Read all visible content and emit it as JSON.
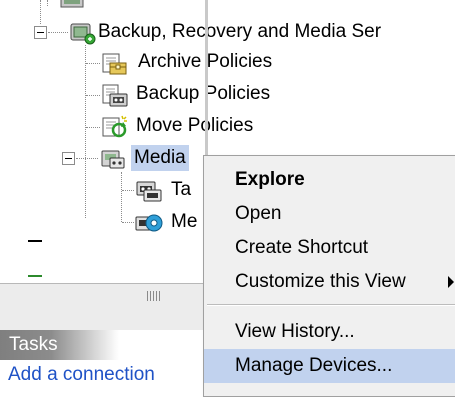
{
  "tree": {
    "root_label": "Backup, Recovery and Media Ser",
    "items": [
      {
        "label": "Archive Policies",
        "icon": "archive-policy-icon"
      },
      {
        "label": "Backup Policies",
        "icon": "backup-policy-icon"
      },
      {
        "label": "Move Policies",
        "icon": "move-policy-icon"
      },
      {
        "label": "Media",
        "icon": "media-icon"
      }
    ],
    "children": [
      {
        "label": "Ta",
        "icon": "tape-icon"
      },
      {
        "label": "Me",
        "icon": "media-pool-icon"
      }
    ]
  },
  "tasks": {
    "title": "Tasks",
    "link": "Add a connection"
  },
  "context_menu": {
    "items": [
      {
        "label": "Explore",
        "bold": true
      },
      {
        "label": "Open"
      },
      {
        "label": "Create Shortcut"
      },
      {
        "label": "Customize this View",
        "submenu": true
      },
      {
        "label": "View History..."
      },
      {
        "label": "Manage Devices...",
        "highlighted": true
      }
    ]
  },
  "colors": {
    "selection": "#c1d2ee",
    "menu_bg": "#f0f0f0",
    "link": "#1f52c6"
  }
}
